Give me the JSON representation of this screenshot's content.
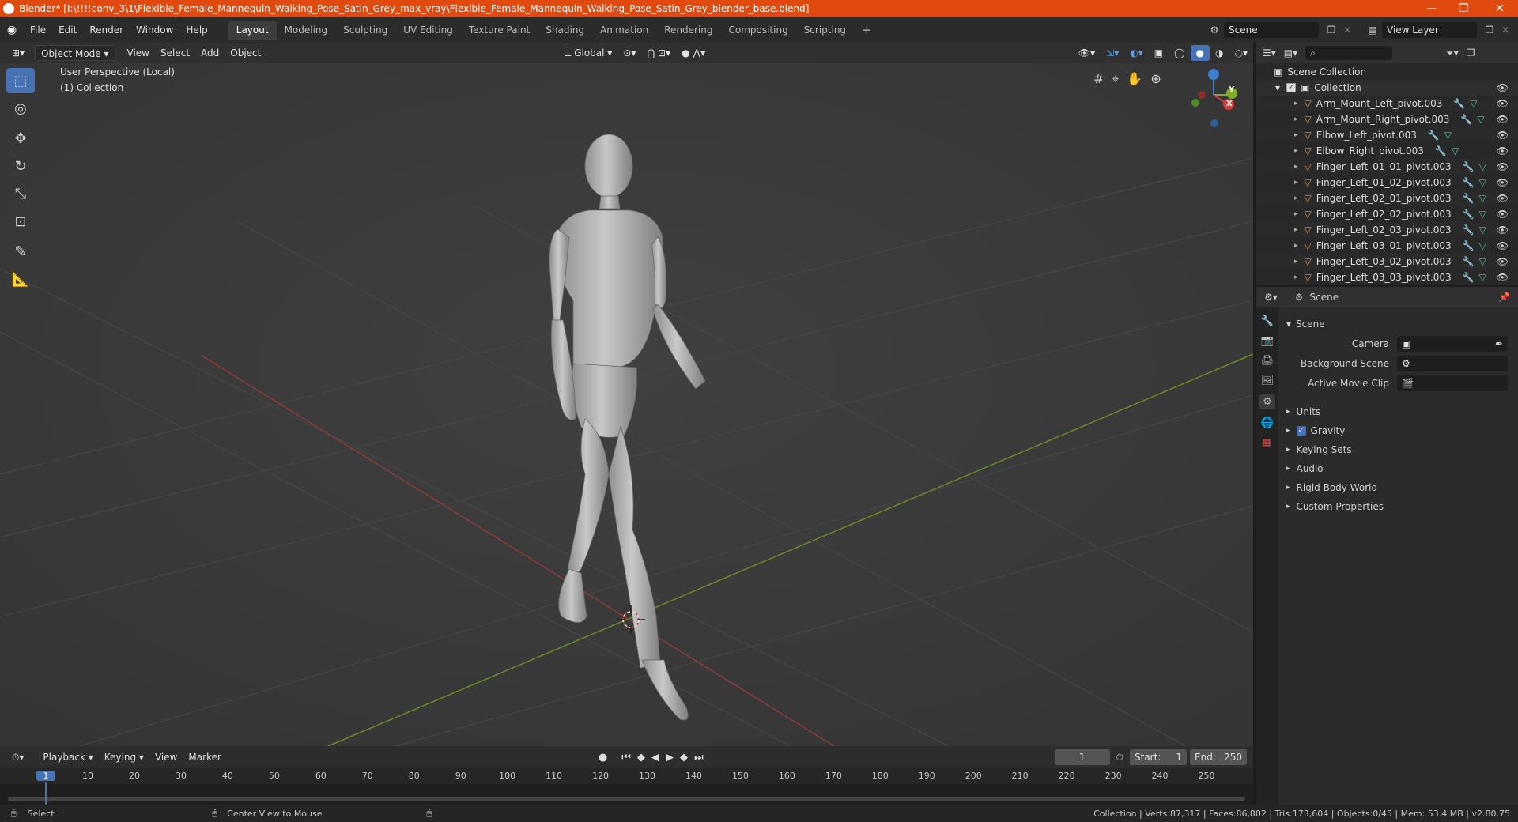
{
  "window": {
    "title": "Blender* [I:\\!!!!conv_3\\1\\Flexible_Female_Mannequin_Walking_Pose_Satin_Grey_max_vray\\Flexible_Female_Mannequin_Walking_Pose_Satin_Grey_blender_base.blend]",
    "controls": [
      "—",
      "❐",
      "✕"
    ],
    "accent": "#e04a0f"
  },
  "menu": [
    "File",
    "Edit",
    "Render",
    "Window",
    "Help"
  ],
  "workspaces": [
    "Layout",
    "Modeling",
    "Sculpting",
    "UV Editing",
    "Texture Paint",
    "Shading",
    "Animation",
    "Rendering",
    "Compositing",
    "Scripting"
  ],
  "active_workspace": "Layout",
  "scene_field": "Scene",
  "view_layer_field": "View Layer",
  "viewport_header": {
    "mode": "Object Mode",
    "menus": [
      "View",
      "Select",
      "Add",
      "Object"
    ],
    "transform_orientation": "Global"
  },
  "viewport": {
    "perspective": "User Perspective (Local)",
    "collection": "(1) Collection",
    "gizmo_axes": [
      "Z",
      "Y",
      "X"
    ]
  },
  "outliner": {
    "root": "Scene Collection",
    "collection": "Collection",
    "items": [
      "Arm_Mount_Left_pivot.003",
      "Arm_Mount_Right_pivot.003",
      "Elbow_Left_pivot.003",
      "Elbow_Right_pivot.003",
      "Finger_Left_01_01_pivot.003",
      "Finger_Left_01_02_pivot.003",
      "Finger_Left_02_01_pivot.003",
      "Finger_Left_02_02_pivot.003",
      "Finger_Left_02_03_pivot.003",
      "Finger_Left_03_01_pivot.003",
      "Finger_Left_03_02_pivot.003",
      "Finger_Left_03_03_pivot.003"
    ]
  },
  "properties": {
    "header": "Scene",
    "panel": "Scene",
    "fields": {
      "camera_label": "Camera",
      "background_scene_label": "Background Scene",
      "active_movie_clip_label": "Active Movie Clip"
    },
    "sections": [
      "Units",
      "Gravity",
      "Keying Sets",
      "Audio",
      "Rigid Body World",
      "Custom Properties"
    ]
  },
  "timeline": {
    "menus": [
      "Playback",
      "Keying",
      "View",
      "Marker"
    ],
    "current_frame": "1",
    "start_label": "Start:",
    "start": "1",
    "end_label": "End:",
    "end": "250",
    "ticks": [
      "1",
      "10",
      "20",
      "30",
      "40",
      "50",
      "60",
      "70",
      "80",
      "90",
      "100",
      "110",
      "120",
      "130",
      "140",
      "150",
      "160",
      "170",
      "180",
      "190",
      "200",
      "210",
      "220",
      "230",
      "240",
      "250"
    ]
  },
  "statusbar": {
    "left_action": "Select",
    "mid_action": "Center View to Mouse",
    "stats": "Collection | Verts:87,317 | Faces:86,802 | Tris:173,604 | Objects:0/45 | Mem: 53.4 MB | v2.80.75"
  }
}
